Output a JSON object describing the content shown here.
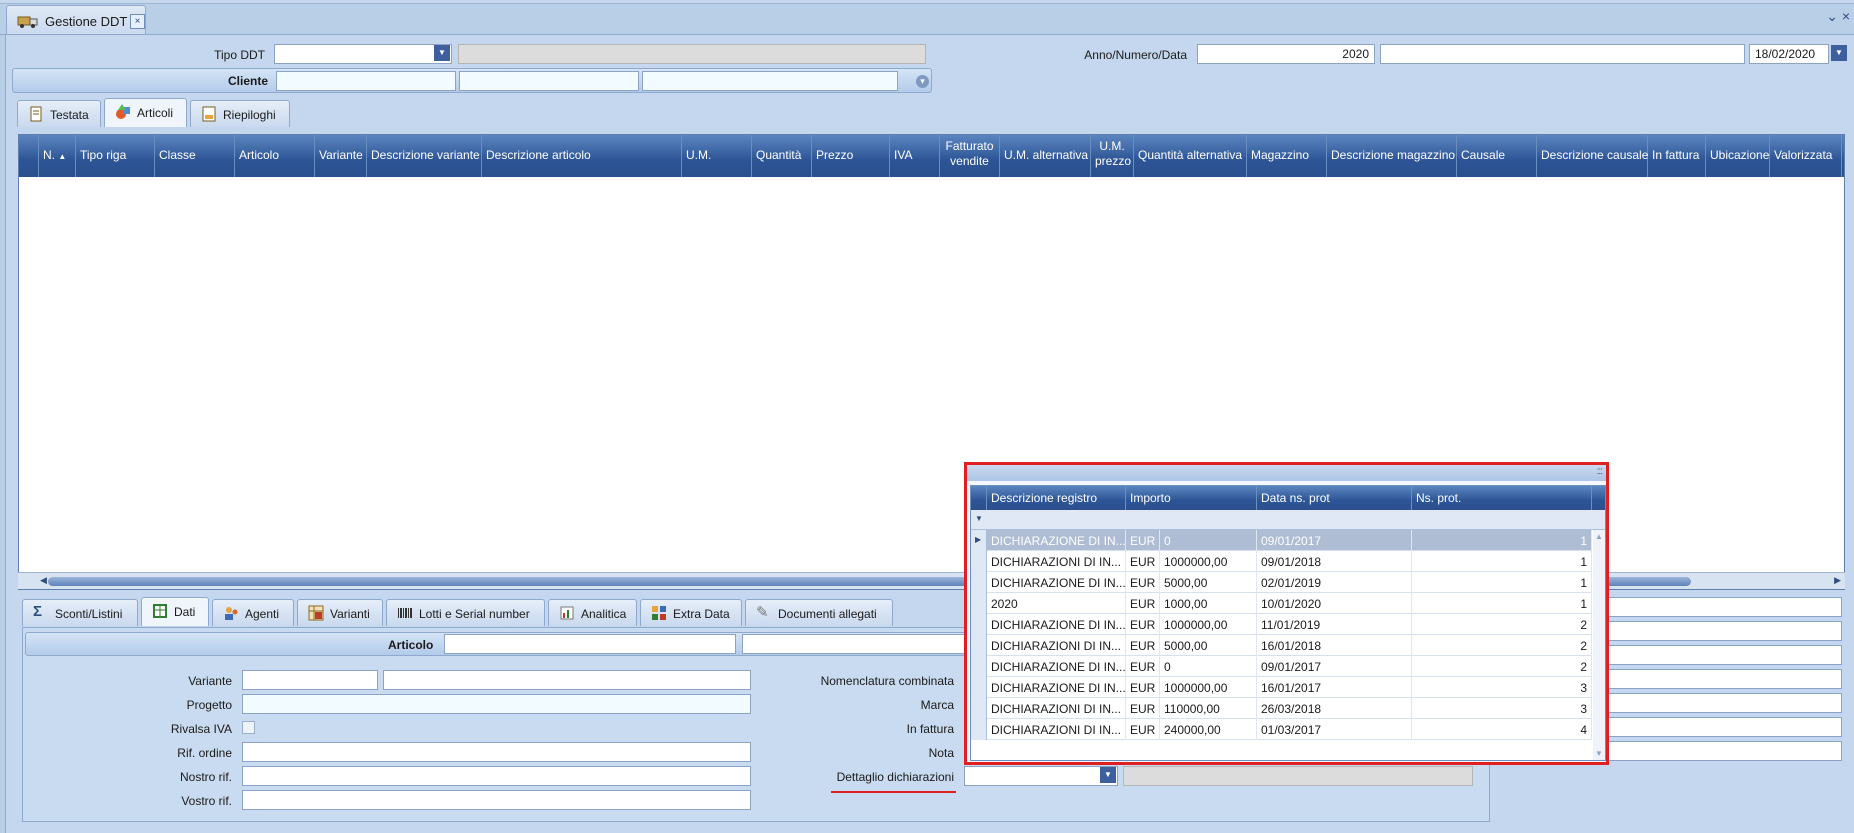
{
  "window": {
    "tab_title": "Gestione DDT",
    "close_glyph": "×",
    "win_close_glyph": "⌄ ×"
  },
  "header": {
    "tipo_ddt_label": "Tipo DDT",
    "tipo_ddt_value": "",
    "anno_label": "Anno/Numero/Data",
    "anno_value": "2020",
    "numero_value": "",
    "data_value": "18/02/2020",
    "cliente_label": "Cliente"
  },
  "main_tabs": [
    {
      "label": "Testata",
      "icon": "document-icon"
    },
    {
      "label": "Articoli",
      "icon": "shapes-icon",
      "active": true
    },
    {
      "label": "Riepiloghi",
      "icon": "summary-icon"
    }
  ],
  "grid": {
    "columns": [
      "N.",
      "Tipo riga",
      "Classe",
      "Articolo",
      "Variante",
      "Descrizione variante",
      "Descrizione articolo",
      "U.M.",
      "Quantità",
      "Prezzo",
      "IVA",
      "Fatturato vendite",
      "U.M. alternativa",
      "U.M. prezzo",
      "Quantità alternativa",
      "Magazzino",
      "Descrizione magazzino",
      "Causale",
      "Descrizione causale",
      "In fattura",
      "Ubicazione",
      "Valorizzata"
    ],
    "sort_glyph": "▲"
  },
  "bottom_tabs": [
    {
      "label": "Sconti/Listini",
      "icon": "sigma-icon"
    },
    {
      "label": "Dati",
      "icon": "spreadsheet-icon",
      "active": true
    },
    {
      "label": "Agenti",
      "icon": "agents-icon"
    },
    {
      "label": "Varianti",
      "icon": "grid-icon"
    },
    {
      "label": "Lotti e Serial number",
      "icon": "barcode-icon"
    },
    {
      "label": "Analitica",
      "icon": "chart-icon"
    },
    {
      "label": "Extra Data",
      "icon": "blocks-icon"
    },
    {
      "label": "Documenti allegati",
      "icon": "paperclip-icon"
    }
  ],
  "dati": {
    "articolo_label": "Articolo",
    "left_labels": [
      "Variante",
      "Progetto",
      "Rivalsa IVA",
      "Rif. ordine",
      "Nostro rif.",
      "Vostro rif."
    ],
    "right_labels": [
      "Nomenclatura combinata",
      "Marca",
      "In fattura",
      "Nota",
      "Dettaglio dichiarazioni"
    ]
  },
  "popup": {
    "grip_glyph": ":::",
    "filter_glyph": "▼",
    "columns": [
      "Descrizione registro",
      "Importo",
      "Data ns. prot",
      "Ns. prot."
    ],
    "rows": [
      {
        "descr": "DICHIARAZIONE DI IN...",
        "cur": "EUR",
        "importo": "0",
        "data": "09/01/2017",
        "prot": "1",
        "selected": true
      },
      {
        "descr": "DICHIARAZIONI DI IN...",
        "cur": "EUR",
        "importo": "1000000,00",
        "data": "09/01/2018",
        "prot": "1"
      },
      {
        "descr": "DICHIARAZIONE DI IN...",
        "cur": "EUR",
        "importo": "5000,00",
        "data": "02/01/2019",
        "prot": "1"
      },
      {
        "descr": "2020",
        "cur": "EUR",
        "importo": "1000,00",
        "data": "10/01/2020",
        "prot": "1"
      },
      {
        "descr": "DICHIARAZIONE DI IN...",
        "cur": "EUR",
        "importo": "1000000,00",
        "data": "11/01/2019",
        "prot": "2"
      },
      {
        "descr": "DICHIARAZIONI DI IN...",
        "cur": "EUR",
        "importo": "5000,00",
        "data": "16/01/2018",
        "prot": "2"
      },
      {
        "descr": "DICHIARAZIONE DI IN...",
        "cur": "EUR",
        "importo": "0",
        "data": "09/01/2017",
        "prot": "2"
      },
      {
        "descr": "DICHIARAZIONE DI IN...",
        "cur": "EUR",
        "importo": "1000000,00",
        "data": "16/01/2017",
        "prot": "3"
      },
      {
        "descr": "DICHIARAZIONI DI IN...",
        "cur": "EUR",
        "importo": "110000,00",
        "data": "26/03/2018",
        "prot": "3"
      },
      {
        "descr": "DICHIARAZIONI DI IN...",
        "cur": "EUR",
        "importo": "240000,00",
        "data": "01/03/2017",
        "prot": "4"
      }
    ]
  },
  "colors": {
    "accent": "#2d5596",
    "highlight": "#e02020",
    "background": "#c4d7ee"
  }
}
